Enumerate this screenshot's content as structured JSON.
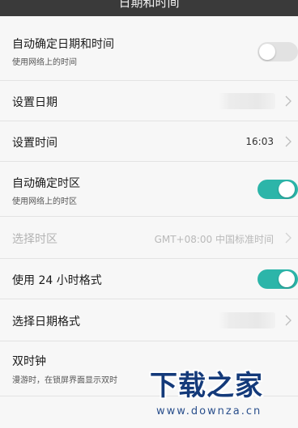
{
  "header": {
    "title": "日期和时间"
  },
  "rows": [
    {
      "title": "自动确定日期和时间",
      "subtitle": "使用网络上的时间",
      "toggle": "off"
    },
    {
      "title": "设置日期"
    },
    {
      "title": "设置时间",
      "value": "16:03"
    },
    {
      "title": "自动确定时区",
      "subtitle": "使用网络上的时区",
      "toggle": "on"
    },
    {
      "title": "选择时区",
      "value": "GMT+08:00 中国标准时间",
      "disabled": true
    },
    {
      "title": "使用 24 小时格式",
      "toggle": "on"
    },
    {
      "title": "选择日期格式"
    },
    {
      "title": "双时钟",
      "subtitle": "漫游时，在锁屏界面显示双时"
    }
  ],
  "colors": {
    "accent": "#2cb5a9",
    "header_bg": "#3a3a3a",
    "background": "#f7f7f7"
  },
  "watermark": {
    "logo": "下载之家",
    "url": "www.downza.cn"
  }
}
